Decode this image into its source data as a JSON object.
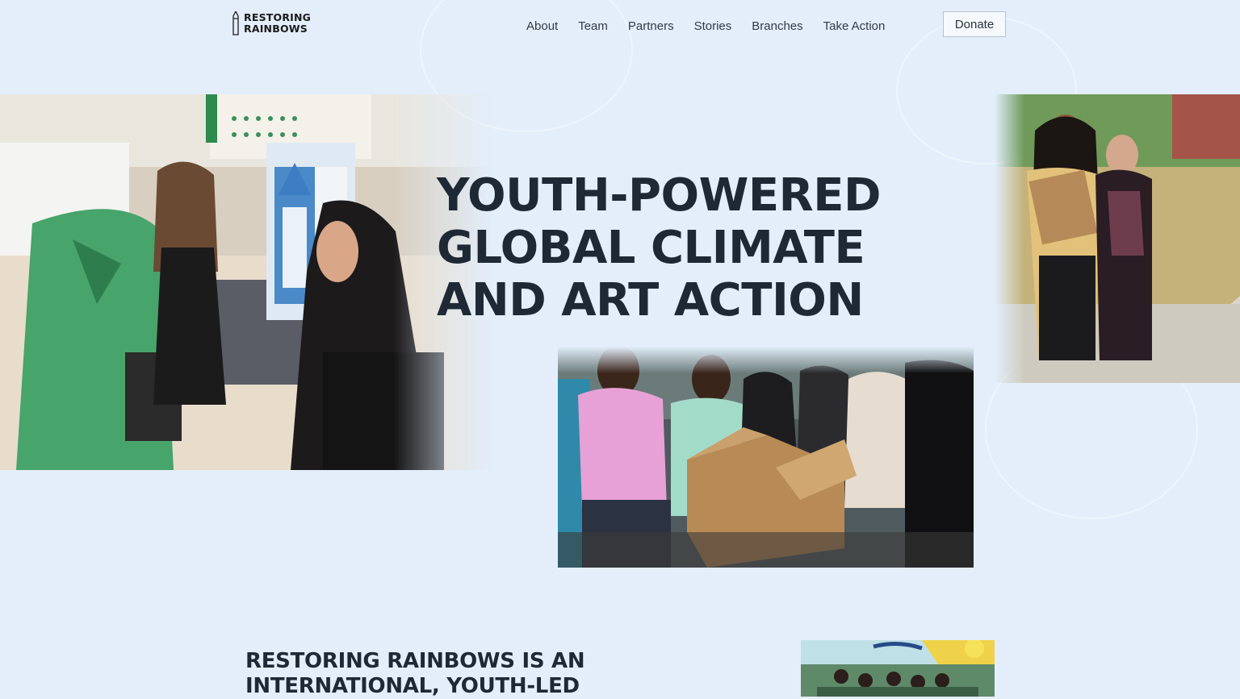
{
  "brand": {
    "line1": "RESTORING",
    "line2": "RAINBOWS"
  },
  "nav": {
    "items": [
      {
        "label": "About"
      },
      {
        "label": "Team"
      },
      {
        "label": "Partners"
      },
      {
        "label": "Stories"
      },
      {
        "label": "Branches"
      },
      {
        "label": "Take Action"
      }
    ],
    "donate_label": "Donate"
  },
  "hero": {
    "title_lines": [
      "YOUTH-POWERED",
      "GLOBAL CLIMATE",
      "AND ART ACTION"
    ]
  },
  "mission": {
    "title_lines": [
      "RESTORING RAINBOWS IS AN",
      "INTERNATIONAL, YOUTH-LED"
    ]
  },
  "colors": {
    "background": "#e3eefa",
    "heading": "#1e2935",
    "nav_text": "#333a44",
    "button_border": "#b7c2cc"
  }
}
